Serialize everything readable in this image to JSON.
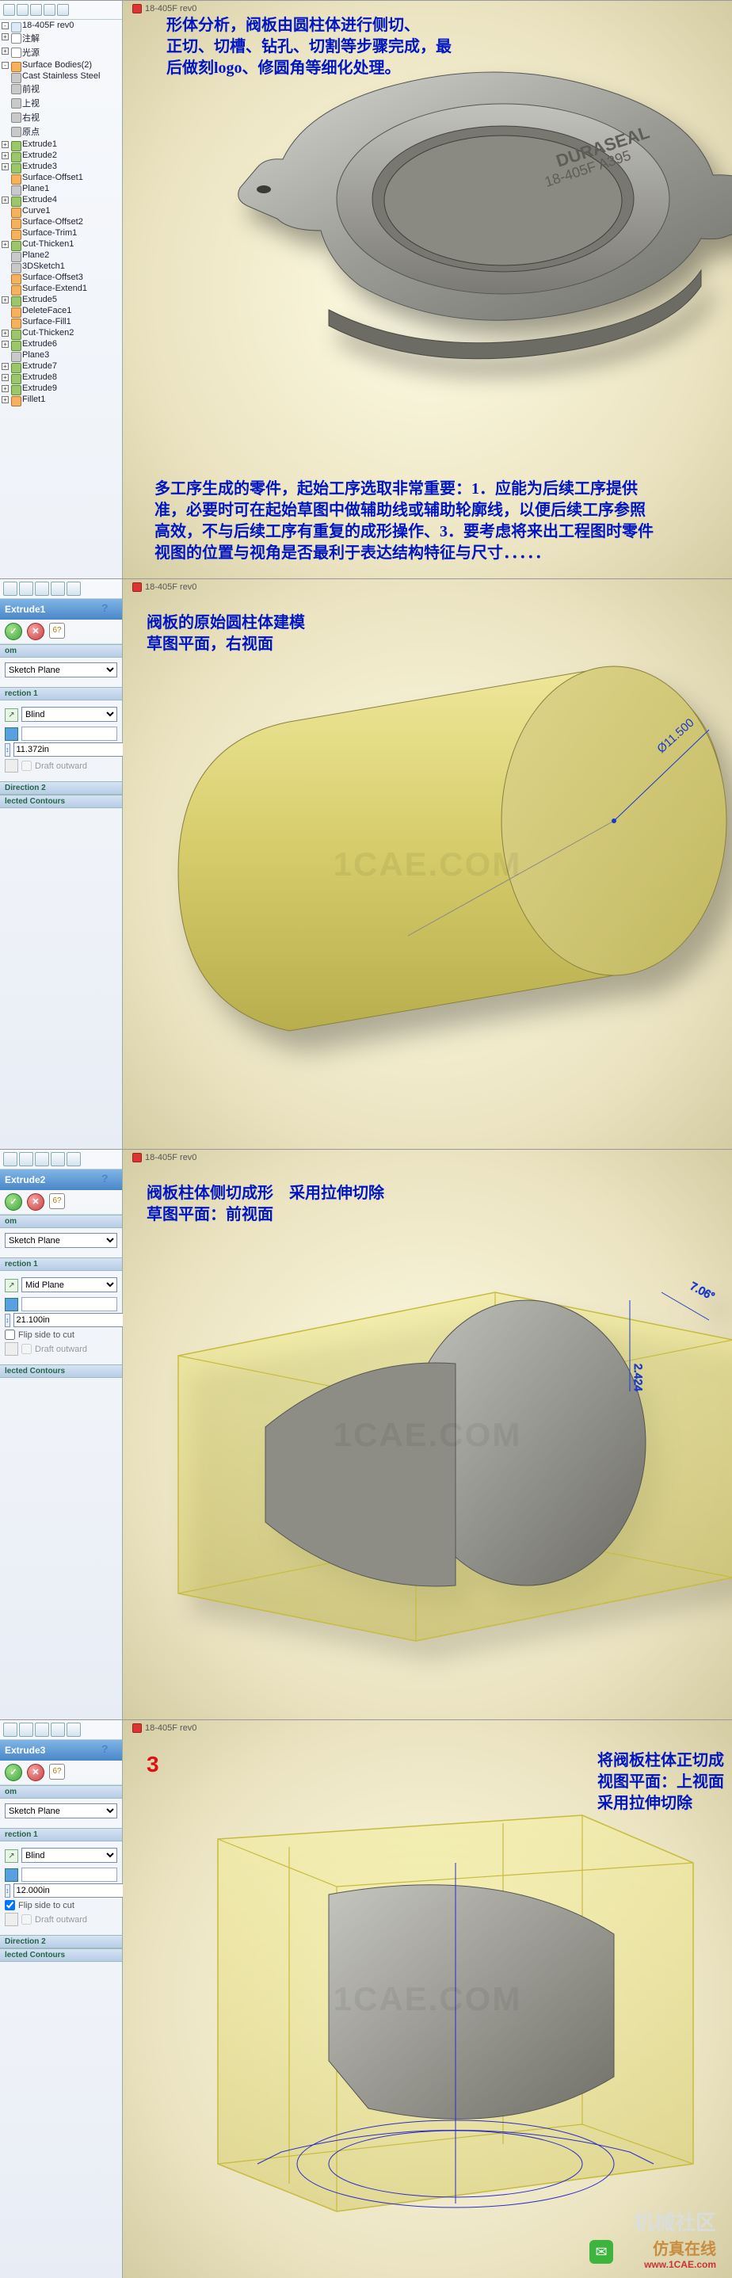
{
  "doc_title": "18-405F rev0",
  "tree_tabs": 5,
  "feature_tree": [
    {
      "label": "18-405F rev0",
      "cls": "doc",
      "tog": "-"
    },
    {
      "label": "注解",
      "cls": "ann",
      "tog": "+"
    },
    {
      "label": "光源",
      "cls": "ann",
      "tog": "+"
    },
    {
      "label": "Surface Bodies(2)",
      "cls": "surf",
      "tog": "-"
    },
    {
      "label": "Cast Stainless Steel",
      "cls": "plane"
    },
    {
      "label": "前视",
      "cls": "plane"
    },
    {
      "label": "上视",
      "cls": "plane"
    },
    {
      "label": "右视",
      "cls": "plane"
    },
    {
      "label": "原点",
      "cls": "plane"
    },
    {
      "label": "Extrude1",
      "cls": "ext",
      "tog": "+"
    },
    {
      "label": "Extrude2",
      "cls": "ext",
      "tog": "+"
    },
    {
      "label": "Extrude3",
      "cls": "ext",
      "tog": "+"
    },
    {
      "label": "Surface-Offset1",
      "cls": "surf"
    },
    {
      "label": "Plane1",
      "cls": "plane"
    },
    {
      "label": "Extrude4",
      "cls": "ext",
      "tog": "+"
    },
    {
      "label": "Curve1",
      "cls": "surf"
    },
    {
      "label": "Surface-Offset2",
      "cls": "surf"
    },
    {
      "label": "Surface-Trim1",
      "cls": "surf"
    },
    {
      "label": "Cut-Thicken1",
      "cls": "ext",
      "tog": "+"
    },
    {
      "label": "Plane2",
      "cls": "plane"
    },
    {
      "label": "3DSketch1",
      "cls": "plane"
    },
    {
      "label": "Surface-Offset3",
      "cls": "surf"
    },
    {
      "label": "Surface-Extend1",
      "cls": "surf"
    },
    {
      "label": "Extrude5",
      "cls": "ext",
      "tog": "+"
    },
    {
      "label": "DeleteFace1",
      "cls": "surf"
    },
    {
      "label": "Surface-Fill1",
      "cls": "surf"
    },
    {
      "label": "Cut-Thicken2",
      "cls": "ext",
      "tog": "+"
    },
    {
      "label": "Extrude6",
      "cls": "ext",
      "tog": "+"
    },
    {
      "label": "Plane3",
      "cls": "plane"
    },
    {
      "label": "Extrude7",
      "cls": "ext",
      "tog": "+"
    },
    {
      "label": "Extrude8",
      "cls": "ext",
      "tog": "+"
    },
    {
      "label": "Extrude9",
      "cls": "ext",
      "tog": "+"
    },
    {
      "label": "Fillet1",
      "cls": "surf",
      "tog": "+"
    }
  ],
  "vp1": {
    "anno1_l1": "形体分析，阀板由圆柱体进行侧切、",
    "anno1_l2": "正切、切槽、钻孔、切割等步骤完成，最",
    "anno1_l3": "后做刻logo、修圆角等细化处理。",
    "emboss_l1": "DURASEAL",
    "emboss_l2": "18-405F A395",
    "anno2_l1": "多工序生成的零件，起始工序选取非常重要：1．应能为后续工序提供",
    "anno2_l2": "准，必要时可在起始草图中做辅助线或辅助轮廓线，以便后续工序参照",
    "anno2_l3": "高效，不与后续工序有重复的成形操作、3．要考虑将来出工程图时零件",
    "anno2_l4": "视图的位置与视角是否最利于表达结构特征与尺寸．．．．．"
  },
  "vp2": {
    "anno_l1": "阀板的原始圆柱体建模",
    "anno_l2": "草图平面，右视面",
    "dim": "Ø11.500"
  },
  "vp3": {
    "anno_l1": "阀板柱体侧切成形　采用拉伸切除",
    "anno_l2": "草图平面：前视面",
    "dim1": "2.424",
    "dim2": "7.06°"
  },
  "vp4": {
    "step": "3",
    "anno_l1": "将阀板柱体正切成",
    "anno_l2": "视图平面：上视面",
    "anno_l3": "采用拉伸切除"
  },
  "pm_shared": {
    "from_hdr": "om",
    "from_val": "Sketch Plane",
    "dir1_hdr": "rection 1",
    "dir2_hdr": "Direction 2",
    "contours_hdr": "lected Contours",
    "draft_label": "Draft outward",
    "flip_label": "Flip side to cut"
  },
  "pm1": {
    "title": "Extrude1",
    "end": "Blind",
    "depth": "11.372in"
  },
  "pm2": {
    "title": "Extrude2",
    "end": "Mid Plane",
    "depth": "21.100in"
  },
  "pm3": {
    "title": "Extrude3",
    "end": "Blind",
    "depth": "12.000in"
  },
  "watermark": "1CAE.COM",
  "footer": {
    "cn": "机械社区",
    "cn2": "仿真在线",
    "url": "www.1CAE.com"
  }
}
